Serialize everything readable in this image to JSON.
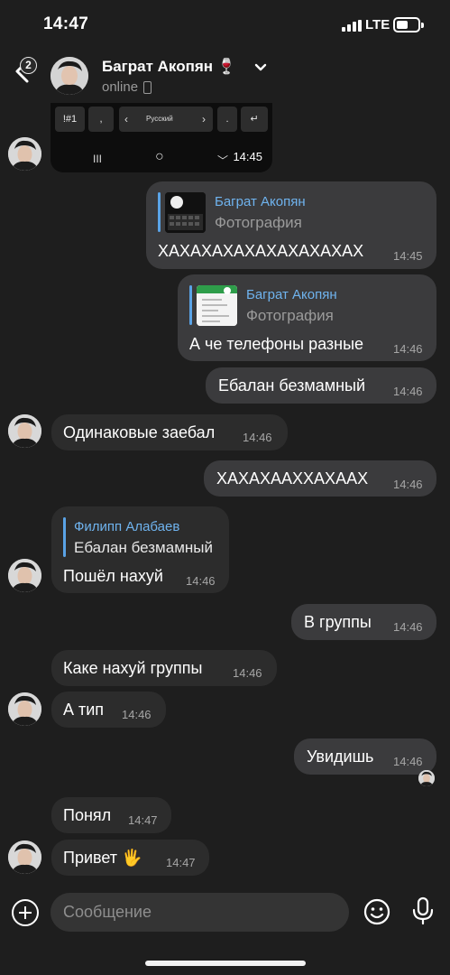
{
  "status_bar": {
    "time": "14:47",
    "network": "LTE",
    "battery_level": 0.5
  },
  "header": {
    "back_badge": "2",
    "contact_name": "Баграт Акопян 🍷",
    "status": "online"
  },
  "keyboard_photo": {
    "key_sym": "!#1",
    "key_comma": ",",
    "key_lang": "Русский",
    "key_prev": "‹",
    "key_next": "›",
    "key_dot": ".",
    "key_enter": "↵",
    "nav_recent": "III",
    "nav_home": "○",
    "nav_back": "﹀",
    "time": "14:45"
  },
  "messages": [
    {
      "id": "m1",
      "direction": "out",
      "reply_name": "Баграт Акопян",
      "reply_sub": "Фотография",
      "text": "ХАХАХАХАХАХАХАХАХАХ",
      "time": "14:45"
    },
    {
      "id": "m2",
      "direction": "out",
      "reply_name": "Баграт Акопян",
      "reply_sub": "Фотография",
      "text": "А че телефоны разные",
      "time": "14:46"
    },
    {
      "id": "m3",
      "direction": "out",
      "text": "Ебалан безмамный",
      "time": "14:46"
    },
    {
      "id": "m4",
      "direction": "in",
      "text": "Одинаковые заебал",
      "time": "14:46"
    },
    {
      "id": "m5",
      "direction": "out",
      "text": "ХАХАХААХХАХААХ",
      "time": "14:46"
    },
    {
      "id": "m6",
      "direction": "in",
      "reply_name": "Филипп Алабаев",
      "reply_text": "Ебалан безмамный",
      "text": "Пошёл нахуй",
      "time": "14:46"
    },
    {
      "id": "m7",
      "direction": "out",
      "text": "В группы",
      "time": "14:46"
    },
    {
      "id": "m8",
      "direction": "in",
      "text": "Каке нахуй группы",
      "time": "14:46"
    },
    {
      "id": "m9",
      "direction": "in",
      "text": "А тип",
      "time": "14:46"
    },
    {
      "id": "m10",
      "direction": "out",
      "text": "Увидишь",
      "time": "14:46"
    },
    {
      "id": "m11",
      "direction": "in",
      "text": "Понял",
      "time": "14:47"
    },
    {
      "id": "m12",
      "direction": "in",
      "text": "Привет 🖐️",
      "time": "14:47"
    }
  ],
  "composer": {
    "placeholder": "Сообщение"
  },
  "colors": {
    "background": "#1e1e1e",
    "incoming_bubble": "#2c2c2c",
    "outgoing_bubble": "#3b3b3d",
    "reply_accent": "#5aa3e6",
    "timestamp": "#a6a6a6"
  },
  "icons": [
    "back-icon",
    "chevron-down-icon",
    "phone-icon",
    "plus-icon",
    "emoji-icon",
    "microphone-icon"
  ]
}
